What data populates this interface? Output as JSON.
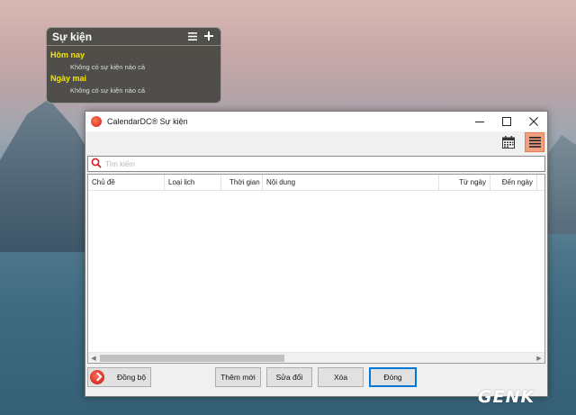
{
  "gadget": {
    "title": "Sự kiện",
    "menu_icon": "menu-icon",
    "add_icon": "plus-icon",
    "days": [
      {
        "label": "Hôm nay",
        "empty_text": "Không có sự kiện nào cả"
      },
      {
        "label": "Ngày mai",
        "empty_text": "Không có sự kiện nào cả"
      }
    ]
  },
  "window": {
    "title": "CalendarDC® Sự kiện",
    "minimize": "—",
    "maximize": "☐",
    "close": "✕"
  },
  "toolbar": {
    "calendar_view_icon": "calendar-icon",
    "list_view_icon": "list-icon",
    "active_view": "list"
  },
  "search": {
    "placeholder": "Tìm kiếm",
    "value": ""
  },
  "table": {
    "columns": [
      "Chủ đề",
      "Loại lịch",
      "Thời gian",
      "Nội dung",
      "Từ ngày",
      "Đến ngày"
    ],
    "rows": []
  },
  "footer": {
    "sync_label": "Đồng bộ",
    "add_label": "Thêm mới",
    "edit_label": "Sửa đổi",
    "delete_label": "Xóa",
    "close_label": "Đóng"
  },
  "watermark": "GENK",
  "colors": {
    "accent": "#f0a07e",
    "gadget_day": "#f3e600",
    "primary_button_border": "#0078d7"
  }
}
